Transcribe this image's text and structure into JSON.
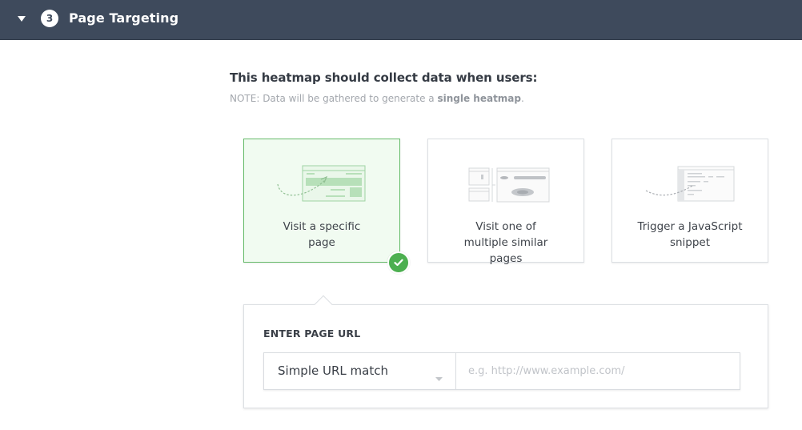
{
  "header": {
    "step_number": "3",
    "title": "Page Targeting",
    "collapse_icon": "triangle-down-icon"
  },
  "prompt": {
    "heading": "This heatmap should collect data when users:",
    "note_prefix": "NOTE: Data will be gathered to generate a ",
    "note_emphasis": "single heatmap",
    "note_suffix": "."
  },
  "options": [
    {
      "label": "Visit a specific page",
      "icon": "single-page-arrow-illustration",
      "selected": true
    },
    {
      "label": "Visit one of multiple similar pages",
      "icon": "multiple-pages-heatmap-illustration",
      "selected": false
    },
    {
      "label": "Trigger a JavaScript snippet",
      "icon": "javascript-trigger-illustration",
      "selected": false
    }
  ],
  "selected_badge_icon": "check-icon",
  "colors": {
    "header_bg": "#3e4a5c",
    "selected_accent": "#4caf50",
    "selected_bg": "#f1fbf1"
  },
  "url_panel": {
    "label": "ENTER PAGE URL",
    "match_type": "Simple URL match",
    "url_value": "",
    "url_placeholder": "e.g. http://www.example.com/"
  }
}
